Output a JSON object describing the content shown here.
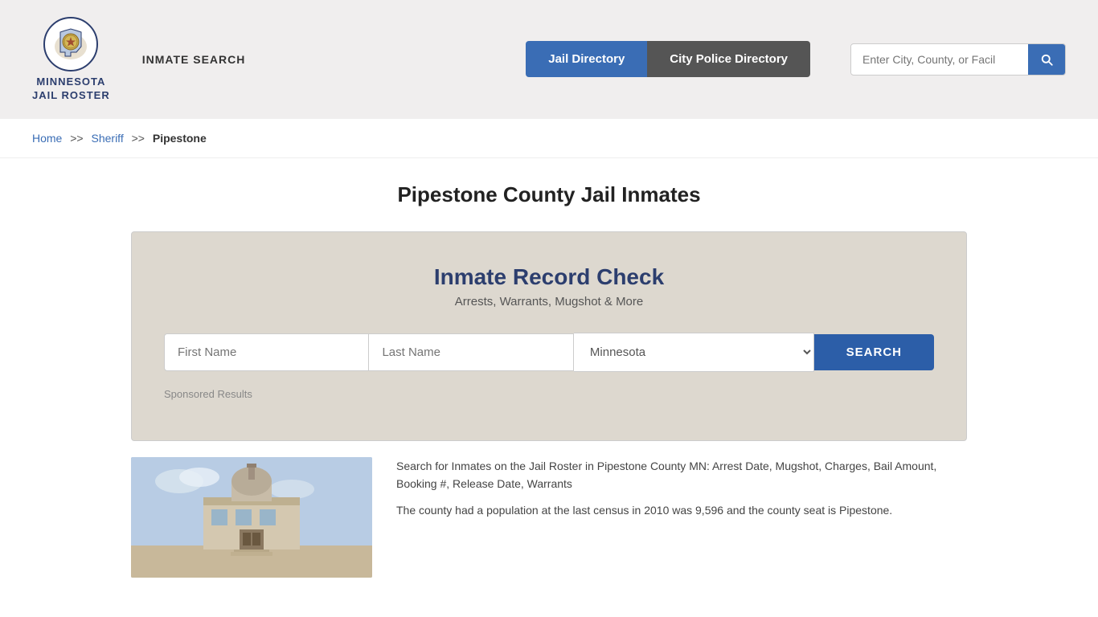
{
  "header": {
    "logo_line1": "MINNESOTA",
    "logo_line2": "JAIL ROSTER",
    "inmate_search_label": "INMATE SEARCH",
    "nav_jail": "Jail Directory",
    "nav_police": "City Police Directory",
    "search_placeholder": "Enter City, County, or Facil"
  },
  "breadcrumb": {
    "home": "Home",
    "separator1": ">>",
    "sheriff": "Sheriff",
    "separator2": ">>",
    "current": "Pipestone"
  },
  "page_title": "Pipestone County Jail Inmates",
  "record_check": {
    "title": "Inmate Record Check",
    "subtitle": "Arrests, Warrants, Mugshot & More",
    "first_name_placeholder": "First Name",
    "last_name_placeholder": "Last Name",
    "state_default": "Minnesota",
    "search_button": "SEARCH",
    "sponsored_label": "Sponsored Results"
  },
  "content": {
    "description": "Search for Inmates on the Jail Roster in Pipestone County MN: Arrest Date, Mugshot, Charges, Bail Amount, Booking #, Release Date, Warrants",
    "description2": "The county had a population at the last census in 2010 was 9,596 and the county seat is Pipestone."
  }
}
